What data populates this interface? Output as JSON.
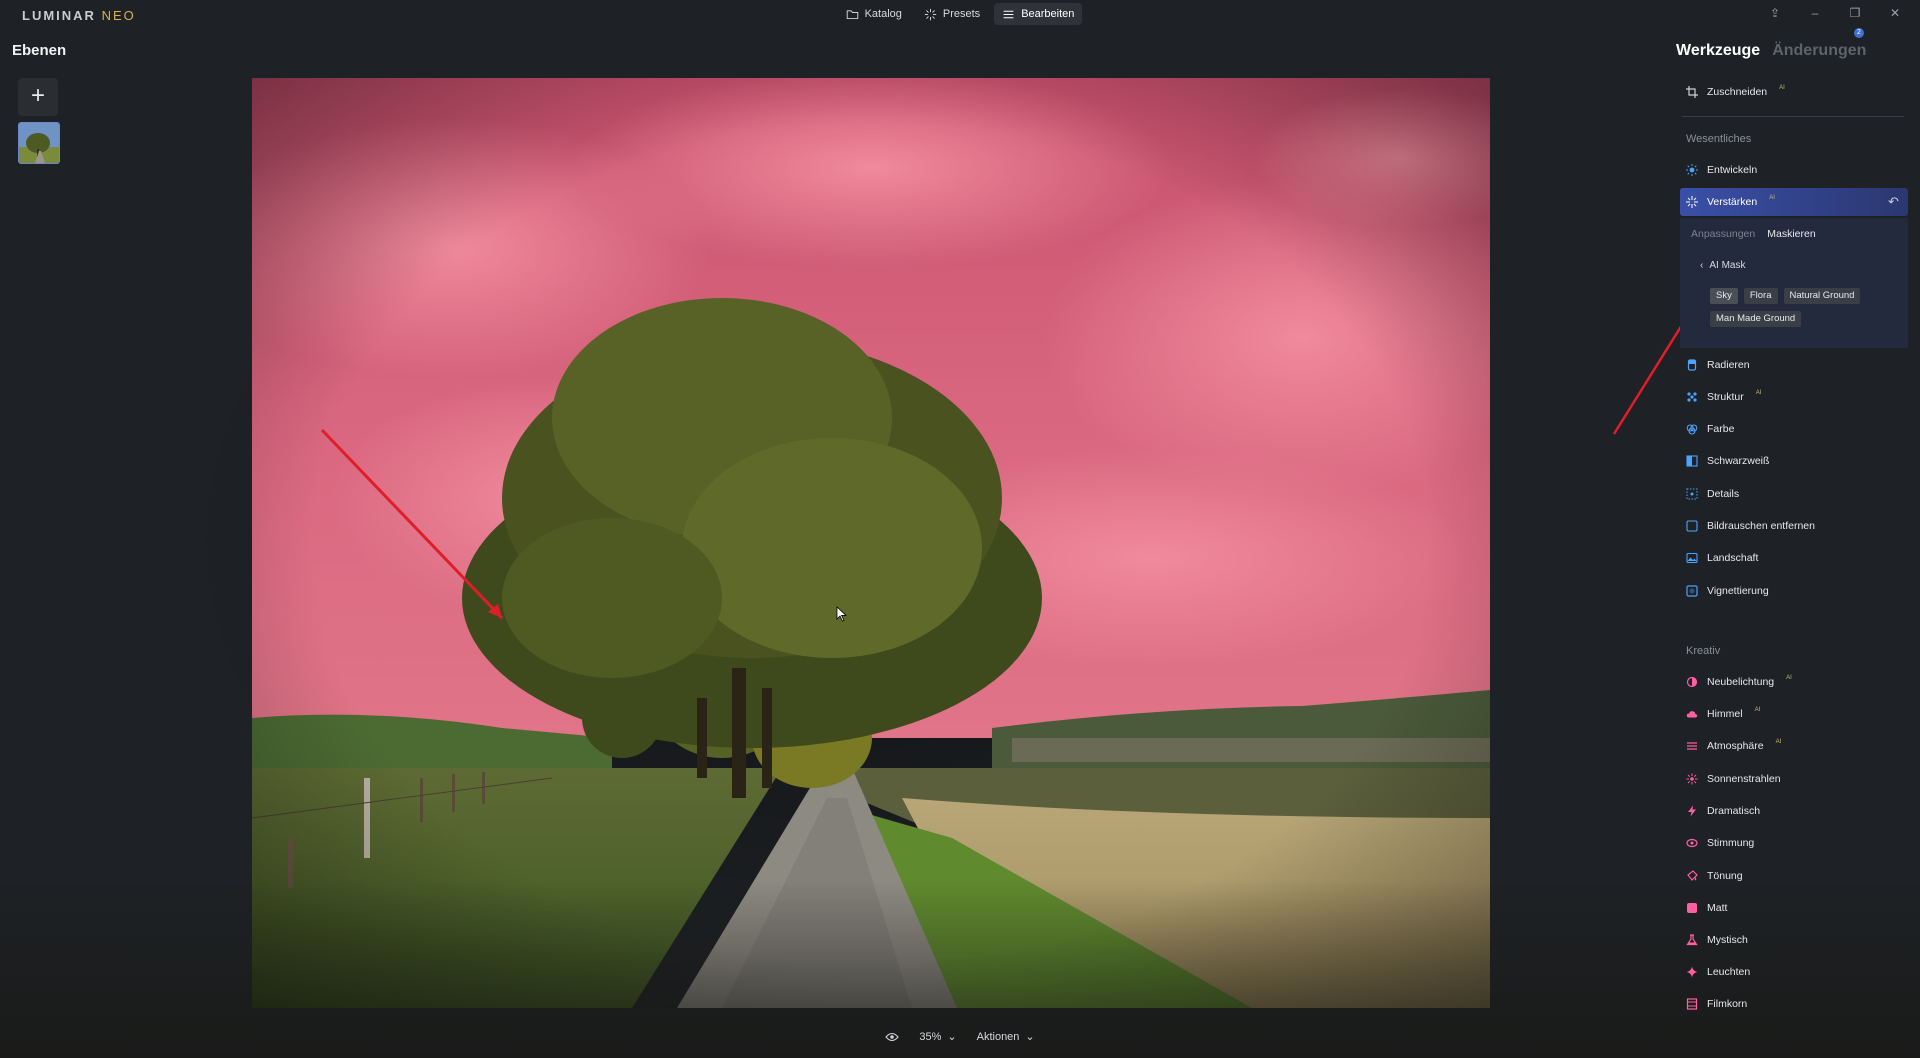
{
  "app": {
    "logo": "LUMINAR",
    "logo_suffix": "NEO"
  },
  "topnav": {
    "items": [
      {
        "label": "Katalog",
        "icon": "folder-icon"
      },
      {
        "label": "Presets",
        "icon": "sparkle-icon"
      },
      {
        "label": "Bearbeiten",
        "icon": "sliders-icon",
        "active": true
      }
    ]
  },
  "window": {
    "notification_count": "2"
  },
  "layers": {
    "title": "Ebenen",
    "add_label": "+"
  },
  "canvas": {
    "mask_color": "#e06c84",
    "mask_target": "Sky"
  },
  "bottombar": {
    "zoom": "35%",
    "actions": "Aktionen"
  },
  "tools_panel": {
    "tab_tools": "Werkzeuge",
    "tab_changes": "Änderungen",
    "crop": "Zuschneiden",
    "essentials_label": "Wesentliches",
    "essentials": [
      {
        "label": "Entwickeln",
        "icon": "sun-icon",
        "color": "#4aa3ff"
      },
      {
        "label": "Verstärken",
        "icon": "sparkle-icon",
        "color": "#ffffff",
        "ai": true,
        "active": true
      },
      {
        "label": "Radieren",
        "icon": "eraser-icon",
        "color": "#4aa3ff"
      },
      {
        "label": "Struktur",
        "icon": "structure-icon",
        "color": "#4aa3ff",
        "ai": true
      },
      {
        "label": "Farbe",
        "icon": "color-icon",
        "color": "#4aa3ff"
      },
      {
        "label": "Schwarzweiß",
        "icon": "bw-icon",
        "color": "#4aa3ff"
      },
      {
        "label": "Details",
        "icon": "details-icon",
        "color": "#4aa3ff"
      },
      {
        "label": "Bildrauschen entfernen",
        "icon": "noise-icon",
        "color": "#4aa3ff"
      },
      {
        "label": "Landschaft",
        "icon": "landscape-icon",
        "color": "#4aa3ff"
      },
      {
        "label": "Vignettierung",
        "icon": "vignette-icon",
        "color": "#4aa3ff"
      }
    ],
    "subtabs": {
      "adjust": "Anpassungen",
      "mask": "Maskieren"
    },
    "ai_mask": {
      "label": "AI Mask",
      "chips": [
        "Sky",
        "Flora",
        "Natural Ground",
        "Man Made Ground"
      ]
    },
    "creative_label": "Kreativ",
    "creative": [
      {
        "label": "Neubelichtung",
        "icon": "relight-icon",
        "color": "#ff5fa2",
        "ai": true
      },
      {
        "label": "Himmel",
        "icon": "cloud-icon",
        "color": "#ff5fa2",
        "ai": true
      },
      {
        "label": "Atmosphäre",
        "icon": "atmosphere-icon",
        "color": "#ff5fa2",
        "ai": true
      },
      {
        "label": "Sonnenstrahlen",
        "icon": "sunrays-icon",
        "color": "#ff5fa2"
      },
      {
        "label": "Dramatisch",
        "icon": "lightning-icon",
        "color": "#ff5fa2"
      },
      {
        "label": "Stimmung",
        "icon": "mood-icon",
        "color": "#ff5fa2"
      },
      {
        "label": "Tönung",
        "icon": "toning-icon",
        "color": "#ff5fa2"
      },
      {
        "label": "Matt",
        "icon": "matte-icon",
        "color": "#ff5fa2"
      },
      {
        "label": "Mystisch",
        "icon": "mystic-icon",
        "color": "#ff5fa2"
      },
      {
        "label": "Leuchten",
        "icon": "glow-icon",
        "color": "#ff5fa2"
      },
      {
        "label": "Filmkorn",
        "icon": "film-icon",
        "color": "#ff5fa2"
      }
    ],
    "ai_badge": "AI"
  }
}
